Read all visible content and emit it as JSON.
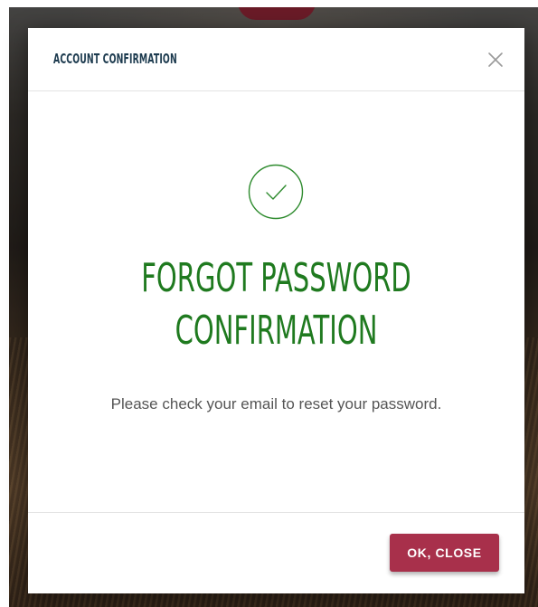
{
  "modal": {
    "title": "ACCOUNT CONFIRMATION",
    "close_icon": "close-icon",
    "status_icon": "check-circle-icon",
    "heading_line1": "FORGOT PASSWORD",
    "heading_line2": "CONFIRMATION",
    "message": "Please check your email to reset your password.",
    "ok_button_label": "OK, CLOSE"
  },
  "colors": {
    "title": "#1d3b4f",
    "heading": "#1f7a1f",
    "check_icon": "#2e8b2e",
    "button": "#a8304b",
    "logo_accent": "#8e2434"
  }
}
